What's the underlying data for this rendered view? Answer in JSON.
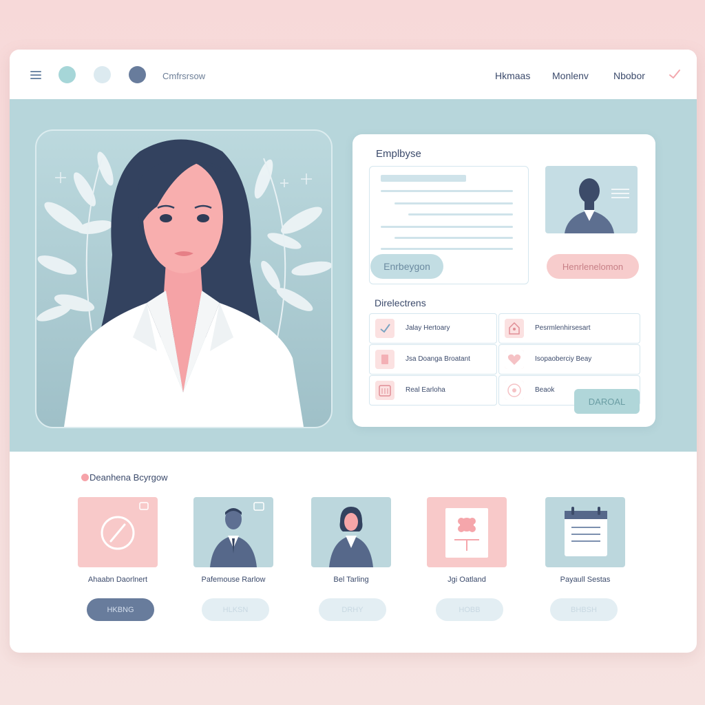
{
  "header": {
    "app_name": "Cmfrsrsow",
    "nav": [
      "Hkmaas",
      "Monlenv",
      "Nbobor"
    ]
  },
  "employee_card": {
    "title": "Emplbyse",
    "primary_button": "Enrbeygon",
    "secondary_button": "Henrlenelomon",
    "section_title": "Direlectrens",
    "directory": [
      {
        "label": "Jalay Hertoary",
        "icon": "check-icon"
      },
      {
        "label": "Pesrmlenhirsesart",
        "icon": "home-icon"
      },
      {
        "label": "Jsa Doanga Broatant",
        "icon": "document-icon"
      },
      {
        "label": "Isopaoberciy Beay",
        "icon": "heart-icon"
      },
      {
        "label": "Real Earloha",
        "icon": "calendar-icon"
      },
      {
        "label": "Beaok",
        "icon": "circle-icon"
      }
    ],
    "action_button": "DAROAL"
  },
  "bottom": {
    "title": "Deanhena Bcyrgow",
    "tiles": [
      {
        "label": "Ahaabn Daorlnert",
        "button": "HKBNG",
        "kind": "primary",
        "icon": "compass-icon"
      },
      {
        "label": "Pafemouse Rarlow",
        "button": "HLKSN",
        "kind": "light",
        "icon": "man-avatar-icon"
      },
      {
        "label": "Bel Tarling",
        "button": "DRHY",
        "kind": "light",
        "icon": "woman-avatar-icon"
      },
      {
        "label": "Jgi Oatland",
        "button": "HOBB",
        "kind": "light",
        "icon": "certificate-icon"
      },
      {
        "label": "Payaull Sestas",
        "button": "BHBSH",
        "kind": "light",
        "icon": "calendar-icon"
      }
    ]
  },
  "colors": {
    "hero_bg": "#b7d6db",
    "navy": "#3b4a6b",
    "pink": "#f7cccc",
    "slate": "#687c9c"
  }
}
